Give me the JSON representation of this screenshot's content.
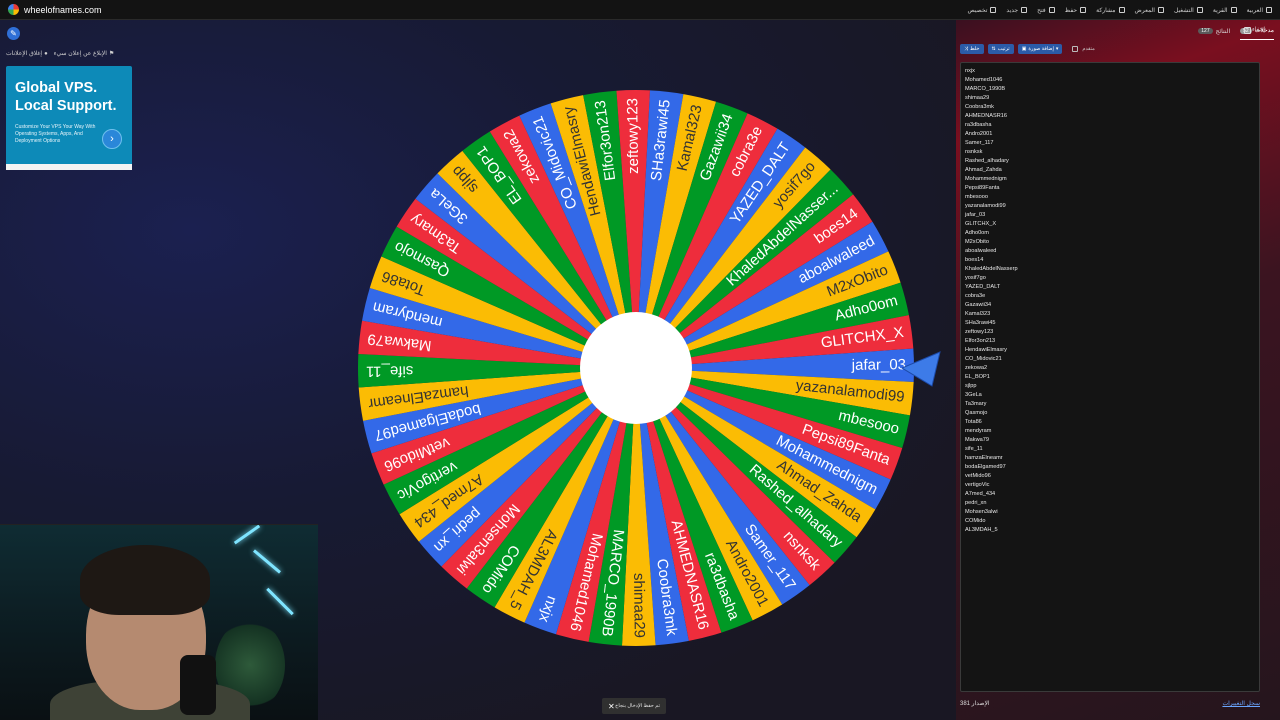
{
  "site": {
    "title": "wheelofnames.com"
  },
  "menu": [
    {
      "label": "العربية",
      "icon": "globe-icon"
    },
    {
      "label": "القرية",
      "icon": "chevron-down-icon"
    },
    {
      "label": "التشغيل",
      "icon": "fullscreen-icon"
    },
    {
      "label": "المعرض",
      "icon": "search-icon"
    },
    {
      "label": "مشاركة",
      "icon": "share-icon"
    },
    {
      "label": "حفظ",
      "icon": "save-icon"
    },
    {
      "label": "فتح",
      "icon": "folder-icon"
    },
    {
      "label": "جديد",
      "icon": "new-file-icon"
    },
    {
      "label": "تخصيص",
      "icon": "palette-icon"
    }
  ],
  "left": {
    "links": [
      "الإبلاغ عن إعلان سيء",
      "إغلاق الإعلانات"
    ]
  },
  "ad": {
    "headline_1": "Global VPS.",
    "headline_2": "Local Support.",
    "body": "Customize Your VPS Your Way With Operating Systems, Apps, And Deployment Options",
    "go": "›"
  },
  "wheel": {
    "colors": [
      "#3369e8",
      "#fbbc04",
      "#009925",
      "#ee2d3c"
    ],
    "segments": [
      "jafar_03",
      "yazanalamodi99",
      "mbesooo",
      "Pepsi89Fanta",
      "Mohammednigm",
      "Ahmad_Zahda",
      "Rashed_alhadary",
      "nsnksk",
      "Samer_117",
      "Andro2001",
      "ra3dbasha",
      "AHMEDNASR16",
      "Coobra3mk",
      "shimaa29",
      "MARCO_1990B",
      "Mohamed1046",
      "nxjx",
      "AL3MDAH_5",
      "COMido",
      "Mohsen3alwi",
      "pedri_xn",
      "A7med_434",
      "vertigoVic",
      "vetMido96",
      "bodaElgamed97",
      "hamzaElneamr",
      "sife_11",
      "Makwa79",
      "mendyram",
      "Tota86",
      "Qasmojo",
      "Ta3mary",
      "3GeLa",
      "sjlpp",
      "EL_BOP1",
      "zekowa2",
      "CO_Midovic21",
      "HendawiElmasry",
      "Elfor3on213",
      "zeftowy123",
      "SHa3rawi45",
      "Kamal323",
      "Gazawii34",
      "cobra3e",
      "YAZED_DALT",
      "yosif7go",
      "KhaledAbdelNasser...",
      "boes14",
      "aboalwaleed",
      "M2xObito",
      "Adho0om",
      "GLITCHX_X"
    ]
  },
  "toast": {
    "text": "تم حفظ الإدخال بنجاح",
    "close": "✕"
  },
  "panel": {
    "tabs": [
      {
        "label": "مدخلات",
        "count": "52",
        "active": true
      },
      {
        "label": "النتائج",
        "count": "127",
        "active": false
      }
    ],
    "hide_label": "إخفاء",
    "toolbar": {
      "shuffle": "خلط",
      "sort": "ترتيب",
      "add_image": "إضافة صورة",
      "advanced": "متقدم"
    },
    "entries": [
      "nxjx",
      "Mohamed1046",
      "MARCO_1990B",
      "shimaa29",
      "Coobra3mk",
      "AHMEDNASR16",
      "ra3dbasha",
      "Andro2001",
      "Samer_117",
      "nsnksk",
      "Rashed_alhadary",
      "Ahmad_Zahda",
      "Mohammednigm",
      "Pepsi89Fanta",
      "mbesooo",
      "yazanalamodi99",
      "jafar_03",
      "GLITCHX_X",
      "Adho0om",
      "M2xObito",
      "aboalwaleed",
      "boes14",
      "KhaledAbdelNasserp",
      "yosif7go",
      "YAZED_DALT",
      "cobra3e",
      "Gazawii34",
      "Kamal323",
      "SHa3rawi45",
      "zeftowy123",
      "Elfor3on213",
      "HendawiElmasry",
      "CO_Midovic21",
      "zekowa2",
      "EL_BOP1",
      "sjlpp",
      "3GeLa",
      "Ta3mary",
      "Qasmojo",
      "Tota86",
      "mendyram",
      "Makwa79",
      "sife_11",
      "hamzaElneamr",
      "bodaElgamed97",
      "vetMido96",
      "vertigoVic",
      "A7med_434",
      "pedri_xn",
      "Mohsen3alwi",
      "COMido",
      "AL3MDAH_5"
    ],
    "footer_version": "الإصدار 381",
    "footer_link": "سجل التغييرات"
  }
}
